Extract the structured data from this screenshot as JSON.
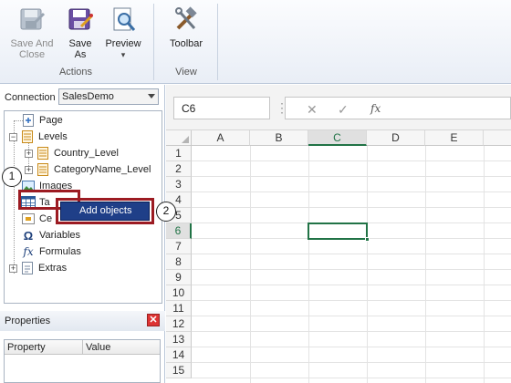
{
  "ribbon": {
    "actions": {
      "save_and_close": "Save And Close",
      "save_as": "Save As",
      "preview": "Preview",
      "preview_arrow": "▾",
      "group_label": "Actions"
    },
    "view": {
      "toolbar": "Toolbar",
      "group_label": "View"
    }
  },
  "connection": {
    "label": "Connection",
    "value": "SalesDemo"
  },
  "tree": {
    "items": [
      {
        "label": "Page"
      },
      {
        "label": "Levels"
      },
      {
        "label": "Country_Level"
      },
      {
        "label": "CategoryName_Level"
      },
      {
        "label": "Images"
      },
      {
        "label": "Tables",
        "visible_text": "Ta"
      },
      {
        "label": "Cells",
        "visible_text": "Ce"
      },
      {
        "label": "Variables"
      },
      {
        "label": "Formulas"
      },
      {
        "label": "Extras"
      }
    ]
  },
  "context_menu": {
    "item": "Add objects"
  },
  "callouts": [
    "1",
    "2"
  ],
  "properties": {
    "title": "Properties",
    "close": "✕",
    "columns": [
      "Property",
      "Value"
    ]
  },
  "sheet": {
    "name_box": "C6",
    "separator": "⋮",
    "cancel": "✕",
    "enter": "✓",
    "fx": "fx",
    "columns": [
      "A",
      "B",
      "C",
      "D",
      "E"
    ],
    "rows": [
      "1",
      "2",
      "3",
      "4",
      "5",
      "6",
      "7",
      "8",
      "9",
      "10",
      "11",
      "12",
      "13",
      "14",
      "15"
    ],
    "selected_column": "C",
    "selected_row": "6"
  },
  "colors": {
    "selection_green": "#217346",
    "highlight_red": "#9c1b22",
    "menu_blue": "#1f3f88"
  }
}
